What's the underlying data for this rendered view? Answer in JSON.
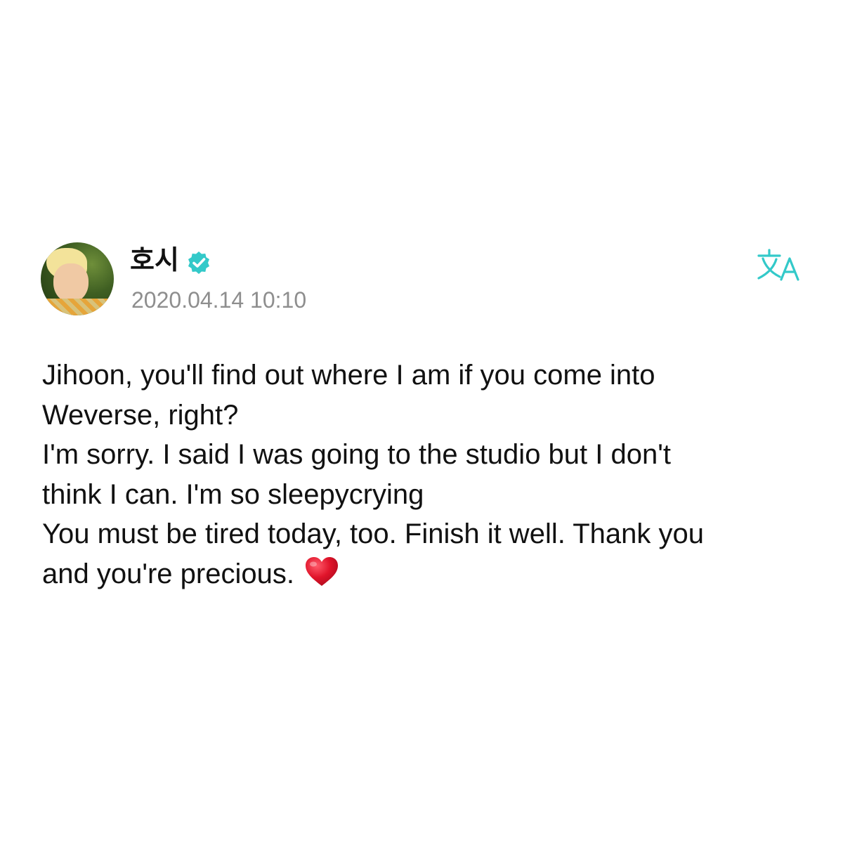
{
  "author": {
    "name": "호시",
    "verified": true,
    "timestamp": "2020.04.14 10:10"
  },
  "post": {
    "lines": [
      "Jihoon, you'll find out where I am if you come into",
      "Weverse, right?",
      "I'm sorry. I said I was going to the studio but I don't",
      "think I can. I'm so sleepycrying",
      "You must be tired today, too. Finish it well. Thank you",
      "and you're precious."
    ],
    "emoji": "heart"
  },
  "icons": {
    "verified": "verified-badge-icon",
    "translate": "translate-icon",
    "heart": "red-heart-emoji"
  },
  "colors": {
    "accent": "#33c9c9",
    "timestamp": "#8e8e8e",
    "text": "#111111",
    "heart": "#e0142a"
  }
}
